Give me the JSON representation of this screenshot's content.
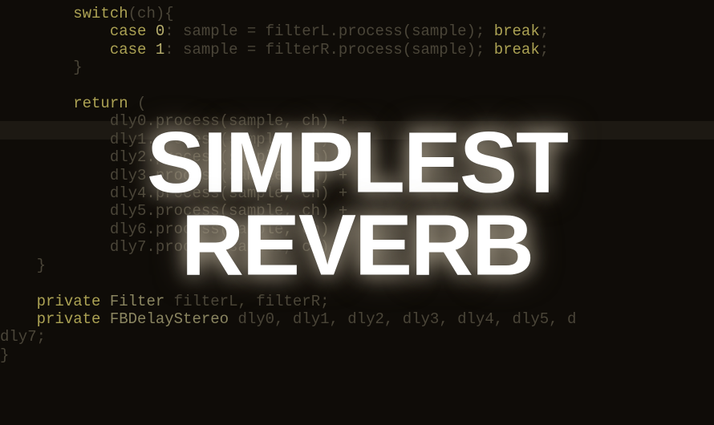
{
  "overlay": {
    "line1": "SIMPLEST",
    "line2": "REVERB"
  },
  "code": {
    "l1_a": "        ",
    "l1_b": "switch",
    "l1_c": "(ch){",
    "l2_a": "            ",
    "l2_b": "case",
    "l2_c": " ",
    "l2_d": "0",
    "l2_e": ": sample = filterL.process(sample); ",
    "l2_f": "break",
    "l2_g": ";",
    "l3_a": "            ",
    "l3_b": "case",
    "l3_c": " ",
    "l3_d": "1",
    "l3_e": ": sample = filterR.process(sample); ",
    "l3_f": "break",
    "l3_g": ";",
    "l4": "        }",
    "l5": "",
    "l6_a": "        ",
    "l6_b": "return",
    "l6_c": " (",
    "l7": "            dly0.process(sample, ch) +",
    "l8": "            dly1.process(sample, ch) +",
    "l9": "            dly2.process(sample, ch) +",
    "l10": "            dly3.process(sample, ch) +",
    "l11": "            dly4.process(sample, ch) +",
    "l12": "            dly5.process(sample, ch) +",
    "l13": "            dly6.process(sample, ch) +",
    "l14": "            dly7.process(sample, ch)",
    "l15": "    }",
    "l16": "",
    "l17_a": "    ",
    "l17_b": "private",
    "l17_c": " ",
    "l17_d": "Filter",
    "l17_e": " filterL, filterR;",
    "l18_a": "    ",
    "l18_b": "private",
    "l18_c": " ",
    "l18_d": "FBDelayStereo",
    "l18_e": " dly0, dly1, dly2, dly3, dly4, dly5, d",
    "l19": "dly7;",
    "l20": "}"
  }
}
